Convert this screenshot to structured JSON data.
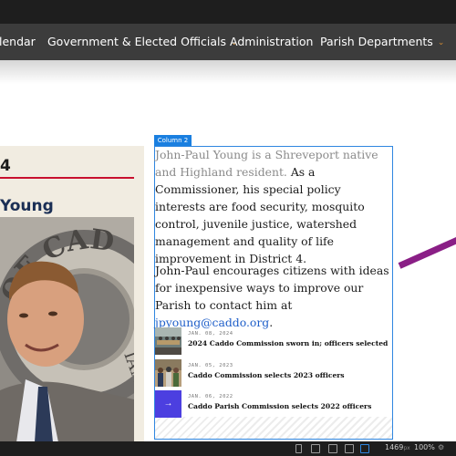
{
  "nav": {
    "items": [
      {
        "label": "lendar"
      },
      {
        "label": "Government & Elected Officials",
        "caret": "⌄"
      },
      {
        "label": "Administration"
      },
      {
        "label": "Parish Departments",
        "caret": "⌄"
      }
    ]
  },
  "profile": {
    "heading_fragment": "4",
    "name_fragment": "Young",
    "seal_text": "CADDO"
  },
  "editor": {
    "column_label": "Column 2"
  },
  "bio": {
    "p1_faded": "John-Paul Young is a Shreveport native and Highland resident.",
    "p1_main": "As a Commissioner, his special policy interests are food security, mosquito control, juvenile justice, watershed management and quality of life improvement in District 4.",
    "p2_prefix": "John-Paul encourages citizens with ideas for inexpensive ways to improve our Parish to contact him at ",
    "p2_email": "jpyoung@caddo.org",
    "p2_suffix": "."
  },
  "news": [
    {
      "date": "JAN. 08, 2024",
      "title": "2024 Caddo Commission sworn in; officers selected"
    },
    {
      "date": "JAN. 05, 2023",
      "title": "Caddo Commission selects 2023 officers"
    },
    {
      "date": "JAN. 06, 2022",
      "title": "Caddo Parish Commission selects 2022 officers",
      "icon": "arrow-right-icon"
    }
  ],
  "statusbar": {
    "width_value": "1469",
    "width_unit": "px",
    "zoom": "100%",
    "active_device": "desktop-icon"
  },
  "colors": {
    "accent_red": "#c8102e",
    "navy": "#1b2f55",
    "link_blue": "#1f5fc9",
    "editor_blue": "#2f86e0",
    "caret_orange": "#d08a34",
    "purple": "#8a1f86"
  }
}
